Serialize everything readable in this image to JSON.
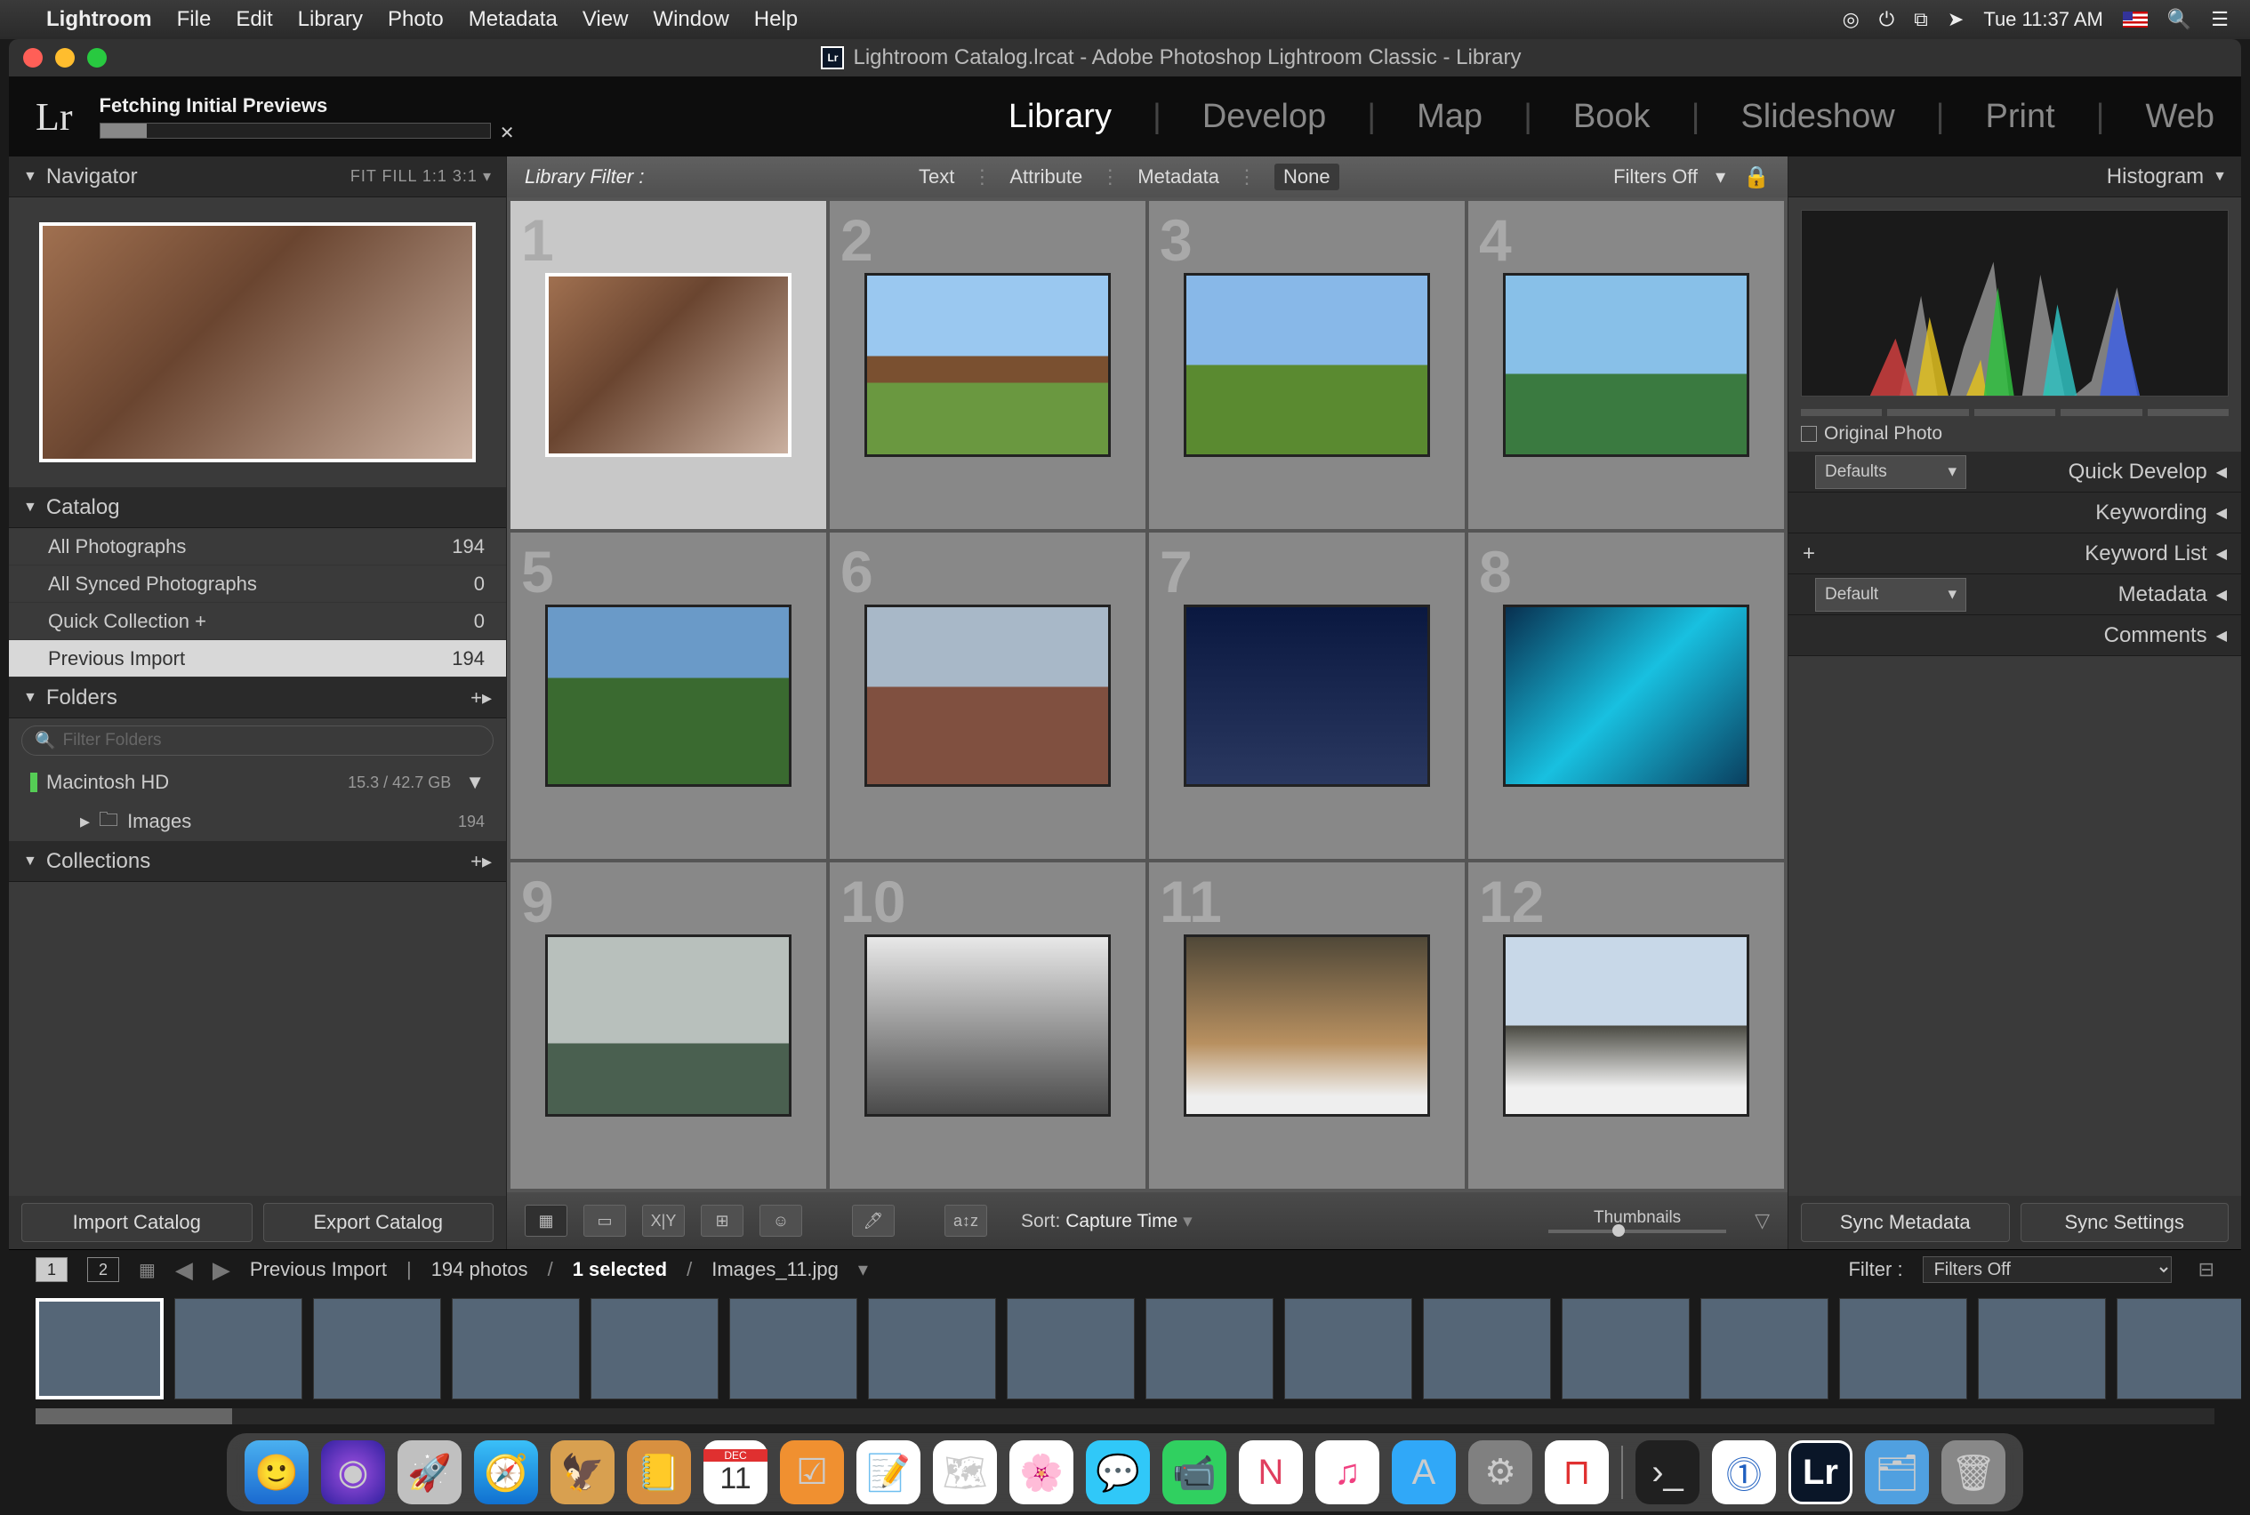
{
  "menubar": {
    "app": "Lightroom",
    "items": [
      "File",
      "Edit",
      "Library",
      "Photo",
      "Metadata",
      "View",
      "Window",
      "Help"
    ],
    "clock": "Tue 11:37 AM"
  },
  "window": {
    "title": "Lightroom Catalog.lrcat - Adobe Photoshop Lightroom Classic - Library"
  },
  "header": {
    "logo": "Lr",
    "fetch_label": "Fetching Initial Previews",
    "modules": [
      "Library",
      "Develop",
      "Map",
      "Book",
      "Slideshow",
      "Print",
      "Web"
    ],
    "active_module": "Library"
  },
  "left": {
    "navigator": {
      "title": "Navigator",
      "opts": "FIT   FILL   1:1   3:1"
    },
    "catalog": {
      "title": "Catalog",
      "rows": [
        {
          "name": "All Photographs",
          "count": "194"
        },
        {
          "name": "All Synced Photographs",
          "count": "0"
        },
        {
          "name": "Quick Collection  +",
          "count": "0"
        },
        {
          "name": "Previous Import",
          "count": "194",
          "selected": true
        }
      ]
    },
    "folders": {
      "title": "Folders",
      "filter_placeholder": "Filter Folders",
      "disk": {
        "name": "Macintosh HD",
        "stats": "15.3 / 42.7 GB"
      },
      "sub": {
        "name": "Images",
        "count": "194"
      }
    },
    "collections": {
      "title": "Collections"
    },
    "import_btn": "Import Catalog",
    "export_btn": "Export Catalog"
  },
  "center": {
    "filterbar": {
      "label": "Library Filter :",
      "items": [
        "Text",
        "Attribute",
        "Metadata",
        "None"
      ],
      "active": "None",
      "filters_off": "Filters Off"
    },
    "toolbar": {
      "sort_label": "Sort:",
      "sort_value": "Capture Time",
      "thumbnails_label": "Thumbnails"
    }
  },
  "right": {
    "histogram": {
      "title": "Histogram",
      "original": "Original Photo"
    },
    "quick_develop": {
      "defaults": "Defaults",
      "title": "Quick Develop"
    },
    "keywording": "Keywording",
    "keyword_list": "Keyword List",
    "metadata": {
      "default": "Default",
      "title": "Metadata"
    },
    "comments": "Comments",
    "sync_meta": "Sync Metadata",
    "sync_settings": "Sync Settings"
  },
  "filmstrip": {
    "breadcrumb": "Previous Import",
    "count": "194 photos",
    "selected": "1 selected",
    "filename": "Images_11.jpg",
    "filter_label": "Filter :",
    "filter_value": "Filters Off"
  },
  "dock": {
    "icons": [
      "finder",
      "siri",
      "launchpad",
      "safari",
      "mail",
      "contacts",
      "calendar",
      "reminders",
      "notes",
      "maps",
      "photos",
      "messages",
      "facetime",
      "news",
      "music",
      "appstore",
      "settings",
      "magnet",
      "terminal",
      "1password",
      "lightroom",
      "downloads",
      "trash"
    ],
    "calendar_day": "11"
  }
}
